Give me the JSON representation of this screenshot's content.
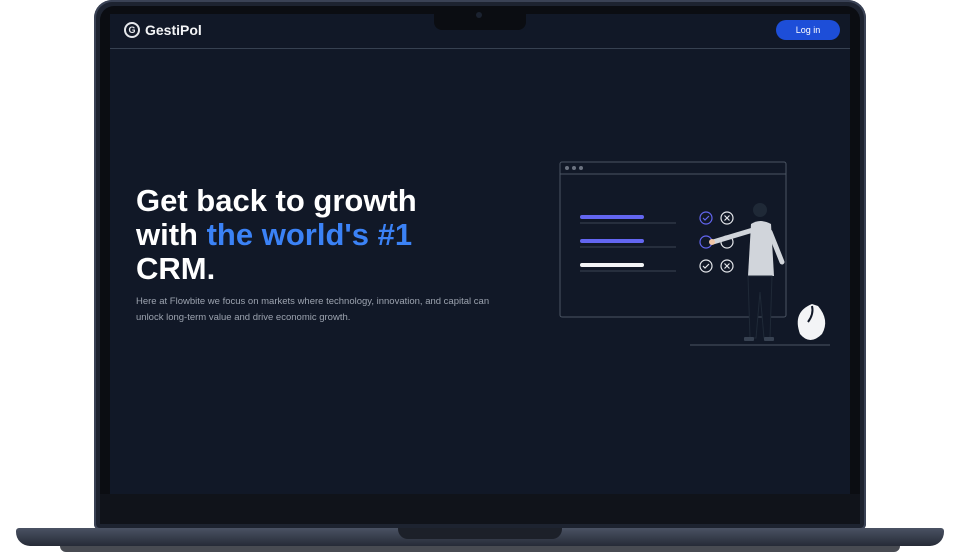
{
  "navbar": {
    "brand_icon": "G",
    "brand_name": "GestiPol",
    "login_label": "Log in"
  },
  "hero": {
    "title_line1": "Get back to growth",
    "title_with": "with ",
    "title_accent": "the world's #1",
    "title_line3": "CRM.",
    "description": "Here at Flowbite we focus on markets where technology, innovation, and capital can unlock long-term value and drive economic growth."
  },
  "colors": {
    "screen_bg": "#111827",
    "accent": "#3b82f6",
    "button": "#1d4ed8",
    "task_bar_purple": "#6366f1"
  },
  "illustration": {
    "icons": [
      "browser-window-icon",
      "check-icon",
      "close-icon",
      "person-icon",
      "plant-icon"
    ]
  }
}
